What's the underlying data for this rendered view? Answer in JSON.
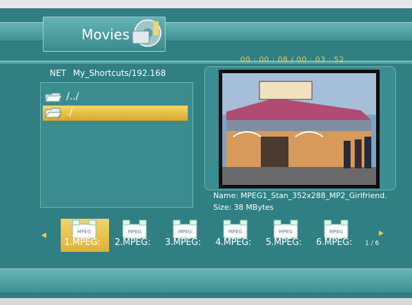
{
  "header": {
    "title": "Movies"
  },
  "browser": {
    "net_label": "NET",
    "path": "My_Shortcuts/192.168",
    "items": [
      {
        "label": "/../",
        "icon": "folder-icon"
      },
      {
        "label": "./",
        "icon": "folder-open-icon",
        "selected": true
      }
    ]
  },
  "player": {
    "current_time": "00 : 00 : 08",
    "separator": "/",
    "total_time": "00 : 03 : 52"
  },
  "file_info": {
    "name_line": "Name: MPEG1_Stan_352x288_MP2_Girlfriend.",
    "size_line": "Size: 38 MBytes"
  },
  "thumbnails": {
    "items": [
      {
        "label": "1.MPEG:",
        "icon_text": "MPEG",
        "selected": true
      },
      {
        "label": "2.MPEG:",
        "icon_text": "MPEG"
      },
      {
        "label": "3.MPEG:",
        "icon_text": "MPEG"
      },
      {
        "label": "4.MPEG:",
        "icon_text": "MPEG"
      },
      {
        "label": "5.MPEG:",
        "icon_text": "MPEG"
      },
      {
        "label": "6.MPEG:",
        "icon_text": "MPEG"
      }
    ],
    "page": "1 / 6"
  },
  "colors": {
    "accent": "#f2c94c",
    "background": "#2f7f83",
    "selection": "#e0b235"
  }
}
